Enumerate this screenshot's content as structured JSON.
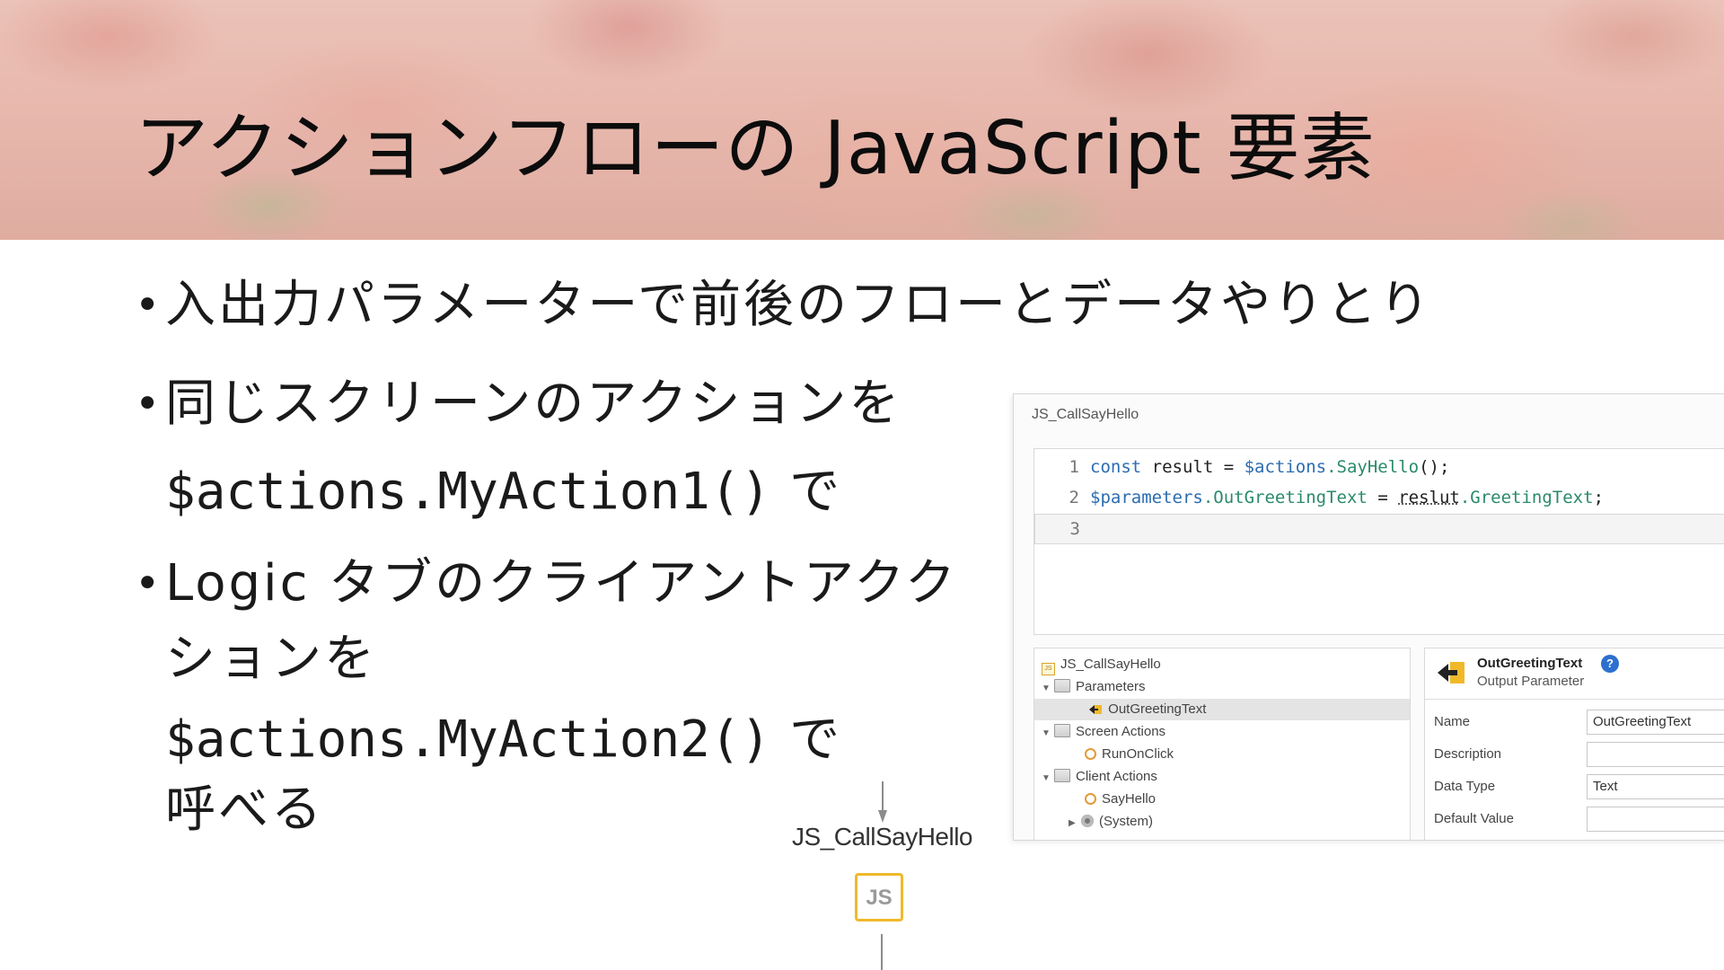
{
  "slide": {
    "title": "アクションフローの JavaScript 要素",
    "bullets": {
      "b1": "入出力パラメーターで前後のフローとデータやりとり",
      "b2_line1": "同じスクリーンのアクションを",
      "b2_code": "$actions.MyAction1()",
      "b2_tail": " で",
      "b3_line1": "Logic タブのクライアントアクク",
      "b3_line2": "ションを",
      "b3_code": "$actions.MyAction2()",
      "b3_tail": " で",
      "b3_line4": "呼べる"
    }
  },
  "editor": {
    "title": "JS_CallSayHello",
    "code": {
      "l1_no": "1",
      "l1_kw": "const",
      "l1_var": " result = ",
      "l1_acc": "$actions",
      "l1_fn": ".SayHello",
      "l1_end": "();",
      "l2_no": "2",
      "l2_acc": "$parameters",
      "l2_fn": ".OutGreetingText",
      "l2_mid": " = ",
      "l2_var": "reslut",
      "l2_fn2": ".GreetingText",
      "l2_end": ";",
      "l3_no": "3"
    },
    "tree": {
      "root": "JS_CallSayHello",
      "parameters": "Parameters",
      "out_param": "OutGreetingText",
      "screen_actions": "Screen Actions",
      "run_on_click": "RunOnClick",
      "client_actions": "Client Actions",
      "say_hello": "SayHello",
      "system": "(System)"
    },
    "properties": {
      "name": "OutGreetingText",
      "kind": "Output Parameter",
      "help": "?",
      "rows": {
        "name_label": "Name",
        "name_value": "OutGreetingText",
        "description_label": "Description",
        "description_value": "",
        "data_type_label": "Data Type",
        "data_type_value": "Text",
        "default_value_label": "Default Value",
        "default_value_value": ""
      }
    }
  },
  "flow": {
    "node_label": "JS_CallSayHello",
    "node_icon": "JS"
  },
  "colors": {
    "accent_blue": "#2b6cb0",
    "method_green": "#2a8a6a",
    "js_node_border": "#f0b92a",
    "help_blue": "#2d6fcf"
  }
}
